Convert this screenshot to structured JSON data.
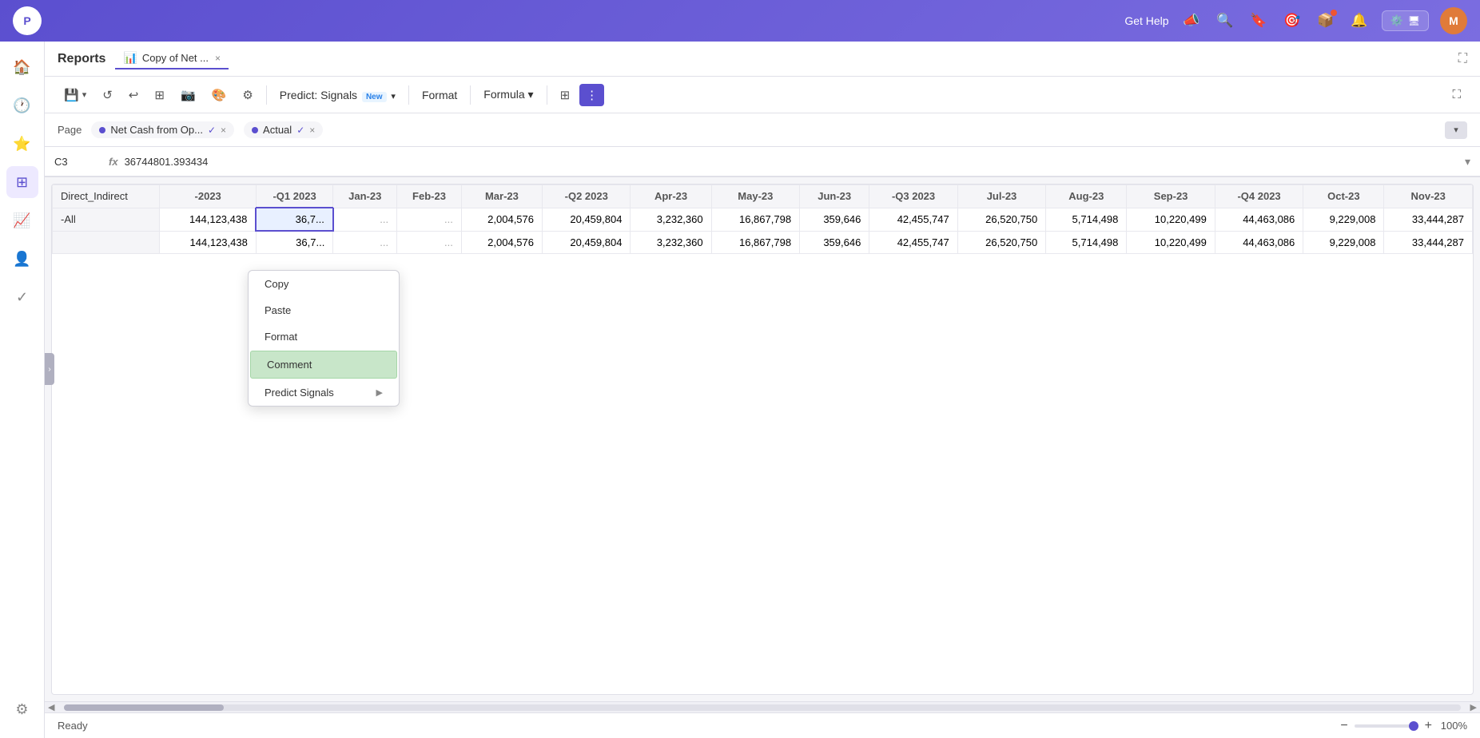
{
  "app": {
    "logo": "P",
    "top_nav": {
      "get_help": "Get Help",
      "avatar": "M",
      "widget_label": "🔧"
    }
  },
  "reports": {
    "title": "Reports",
    "tab": {
      "icon": "📊",
      "label": "Copy of Net ...",
      "close": "×"
    }
  },
  "toolbar": {
    "save_label": "💾",
    "refresh_label": "↺",
    "undo_label": "↩",
    "grid_label": "⊞",
    "camera_label": "📷",
    "paint_label": "🎨",
    "filter_label": "⚙",
    "predict_signals": "Predict: Signals",
    "new_badge": "New",
    "format_label": "Format",
    "formula_label": "Formula",
    "formula_arrow": "▾",
    "grid_view_icon": "⊞",
    "more_icon": "⋮",
    "expand_icon": "⛶"
  },
  "page_filter": {
    "page_label": "Page",
    "filter1": {
      "dot_color": "#5b4fcf",
      "label": "Net Cash from Op...",
      "check": "✓",
      "close": "×"
    },
    "filter2": {
      "dot_color": "#5b4fcf",
      "label": "Actual",
      "check": "✓",
      "close": "×"
    },
    "collapse_btn": "▾"
  },
  "formula_bar": {
    "cell_ref": "C3",
    "fx": "fx",
    "value": "36744801.393434",
    "expand": "▾"
  },
  "grid": {
    "row_header": "Direct_Indirect",
    "columns": [
      "-2023",
      "-Q1 2023",
      "Jan-23",
      "Feb-23",
      "Mar-23",
      "-Q2 2023",
      "Apr-23",
      "May-23",
      "Jun-23",
      "-Q3 2023",
      "Jul-23",
      "Aug-23",
      "Sep-23",
      "-Q4 2023",
      "Oct-23",
      "Nov-23"
    ],
    "rows": [
      {
        "label": "-All",
        "values": [
          "144,123,438",
          "36,7...",
          "...",
          "...",
          "2,004,576",
          "20,459,804",
          "3,232,360",
          "16,867,798",
          "359,646",
          "42,455,747",
          "26,520,750",
          "5,714,498",
          "10,220,499",
          "44,463,086",
          "9,229,008",
          "33,444,287"
        ]
      },
      {
        "label": "",
        "values": [
          "144,123,438",
          "36,7...",
          "...",
          "...",
          "2,004,576",
          "20,459,804",
          "3,232,360",
          "16,867,798",
          "359,646",
          "42,455,747",
          "26,520,750",
          "5,714,498",
          "10,220,499",
          "44,463,086",
          "9,229,008",
          "33,444,287"
        ]
      }
    ]
  },
  "context_menu": {
    "items": [
      {
        "label": "Copy",
        "has_arrow": false
      },
      {
        "label": "Paste",
        "has_arrow": false
      },
      {
        "label": "Format",
        "has_arrow": false
      },
      {
        "label": "Comment",
        "has_arrow": false,
        "highlighted": true
      },
      {
        "label": "Predict Signals",
        "has_arrow": true
      }
    ]
  },
  "status_bar": {
    "status": "Ready",
    "zoom_minus": "−",
    "zoom_plus": "+",
    "zoom_level": "100%"
  }
}
